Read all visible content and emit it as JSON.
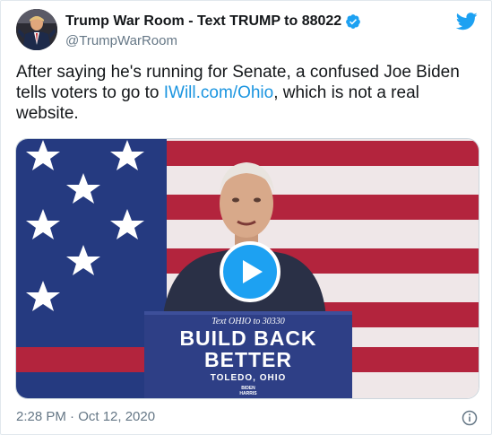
{
  "tweet": {
    "author": {
      "display_name": "Trump War Room - Text TRUMP to 88022",
      "handle": "@TrumpWarRoom",
      "verified": true
    },
    "text_before_link": "After saying he's running for Senate, a confused Joe Biden tells voters to go to ",
    "link_text": "IWill.com/Ohio",
    "text_after_link": ", which is not a real website.",
    "timestamp": "2:28 PM · Oct 12, 2020"
  },
  "video": {
    "podium_line1": "Text OHIO to 30330",
    "podium_line2": "BUILD BACK",
    "podium_line3": "BETTER",
    "podium_line4": "TOLEDO, OHIO",
    "podium_logo_line1": "BIDEN",
    "podium_logo_line2": "HARRIS"
  },
  "icons": {
    "verified": "verified-badge-icon",
    "twitter": "twitter-bird-icon",
    "play": "play-icon",
    "info": "info-icon"
  },
  "colors": {
    "accent": "#1da1f2",
    "link": "#1b95e0",
    "muted": "#657786",
    "podium": "#2e3f86"
  }
}
